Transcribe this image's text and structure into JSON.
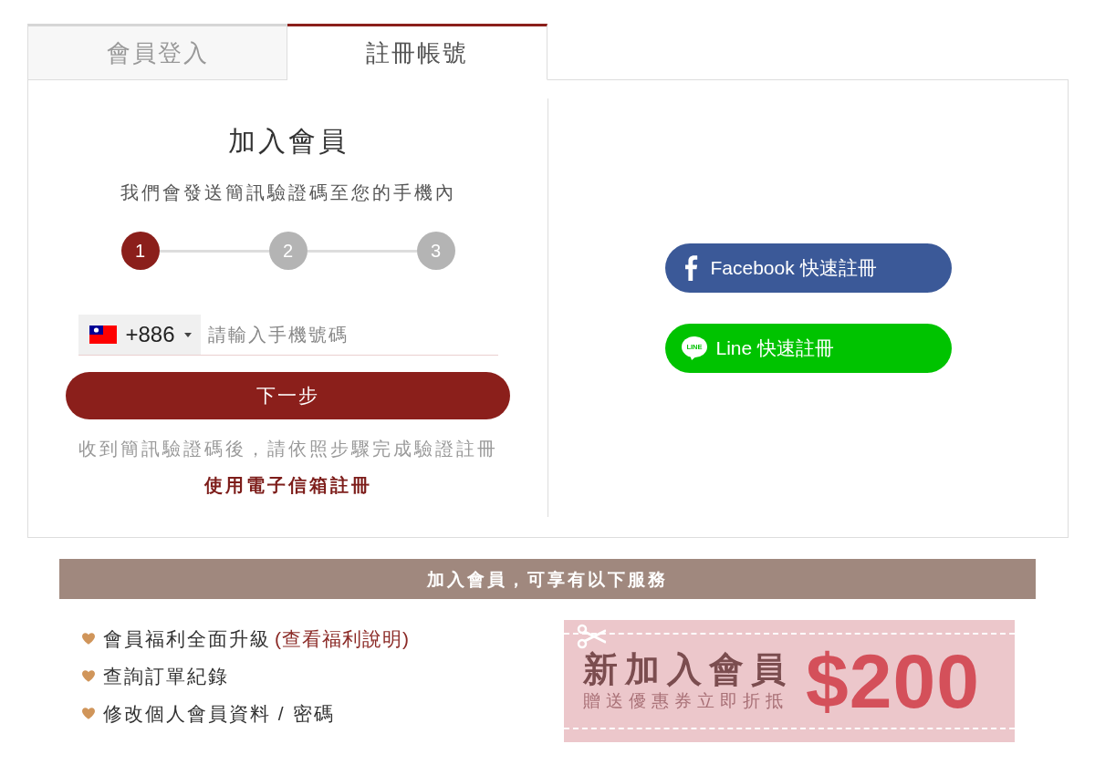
{
  "tabs": [
    {
      "label": "會員登入",
      "selected": false
    },
    {
      "label": "註冊帳號",
      "selected": true
    }
  ],
  "signup": {
    "title": "加入會員",
    "subtitle": "我們會發送簡訊驗證碼至您的手機內",
    "steps": [
      {
        "label": "1",
        "selected": true
      },
      {
        "label": "2",
        "selected": false
      },
      {
        "label": "3",
        "selected": false
      }
    ],
    "phone": {
      "country_code": "+886",
      "placeholder": "請輸入手機號碼"
    },
    "next_button": "下一步",
    "hint": "收到簡訊驗證碼後，請依照步驟完成驗證註冊",
    "email_link": "使用電子信箱註冊"
  },
  "social_buttons": [
    {
      "kind": "facebook",
      "label": "Facebook 快速註冊"
    },
    {
      "kind": "line",
      "label": "Line 快速註冊",
      "logo_text": "LINE"
    }
  ],
  "benefits": {
    "heading": "加入會員，可享有以下服務",
    "items": [
      {
        "text": "會員福利全面升級",
        "link": "(查看福利說明)"
      },
      {
        "text": "查詢訂單紀錄"
      },
      {
        "text": "修改個人會員資料 / 密碼"
      }
    ]
  },
  "coupon": {
    "title": "新加入會員",
    "subtitle": "贈送優惠券立即折抵",
    "amount": "$200"
  }
}
